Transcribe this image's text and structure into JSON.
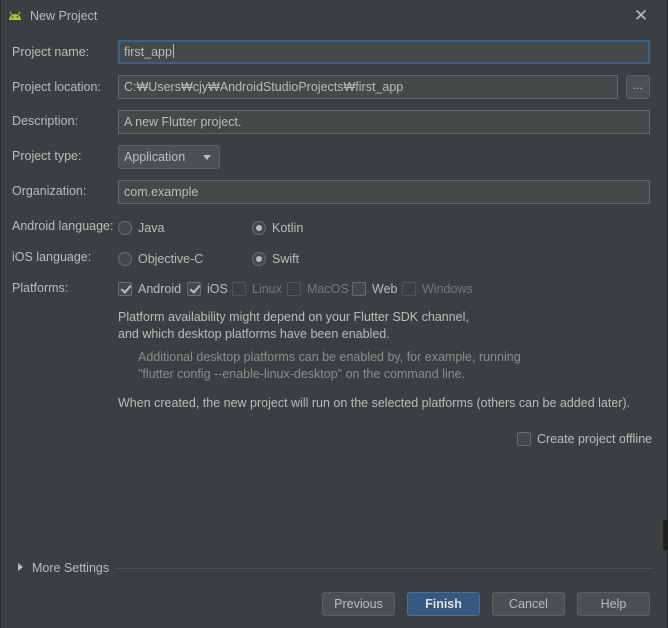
{
  "window": {
    "title": "New Project",
    "close_glyph": "✕",
    "icon": "android-icon"
  },
  "form": {
    "project_name": {
      "label": "Project name:",
      "value": "first_app"
    },
    "project_location": {
      "label": "Project location:",
      "value": "C:₩Users₩cjy₩AndroidStudioProjects₩first_app",
      "browse_label": "..."
    },
    "description": {
      "label": "Description:",
      "value": "A new Flutter project."
    },
    "project_type": {
      "label": "Project type:",
      "value": "Application"
    },
    "organization": {
      "label": "Organization:",
      "value": "com.example"
    },
    "android_language": {
      "label": "Android language:",
      "options": [
        "Java",
        "Kotlin"
      ],
      "selected": "Kotlin"
    },
    "ios_language": {
      "label": "iOS language:",
      "options": [
        "Objective-C",
        "Swift"
      ],
      "selected": "Swift"
    },
    "platforms": {
      "label": "Platforms:",
      "items": [
        {
          "name": "Android",
          "checked": true,
          "enabled": true
        },
        {
          "name": "iOS",
          "checked": true,
          "enabled": true
        },
        {
          "name": "Linux",
          "checked": false,
          "enabled": false
        },
        {
          "name": "MacOS",
          "checked": false,
          "enabled": false
        },
        {
          "name": "Web",
          "checked": false,
          "enabled": true
        },
        {
          "name": "Windows",
          "checked": false,
          "enabled": false
        }
      ]
    }
  },
  "info": {
    "line1": "Platform availability might depend on your Flutter SDK channel,",
    "line2": "and which desktop platforms have been enabled.",
    "hint1": "Additional desktop platforms can be enabled by, for example, running",
    "hint2": "\"flutter config --enable-linux-desktop\" on the command line.",
    "note": "When created, the new project will run on the selected platforms (others can be added later)."
  },
  "offline": {
    "label": "Create project offline",
    "checked": false
  },
  "more_settings": {
    "label": "More Settings"
  },
  "buttons": {
    "previous": "Previous",
    "finish": "Finish",
    "cancel": "Cancel",
    "help": "Help"
  },
  "colors": {
    "background": "#3c3f41",
    "field": "#45494a",
    "focus": "#3d6185",
    "primary_button": "#365880",
    "android_green": "#a4c639"
  }
}
